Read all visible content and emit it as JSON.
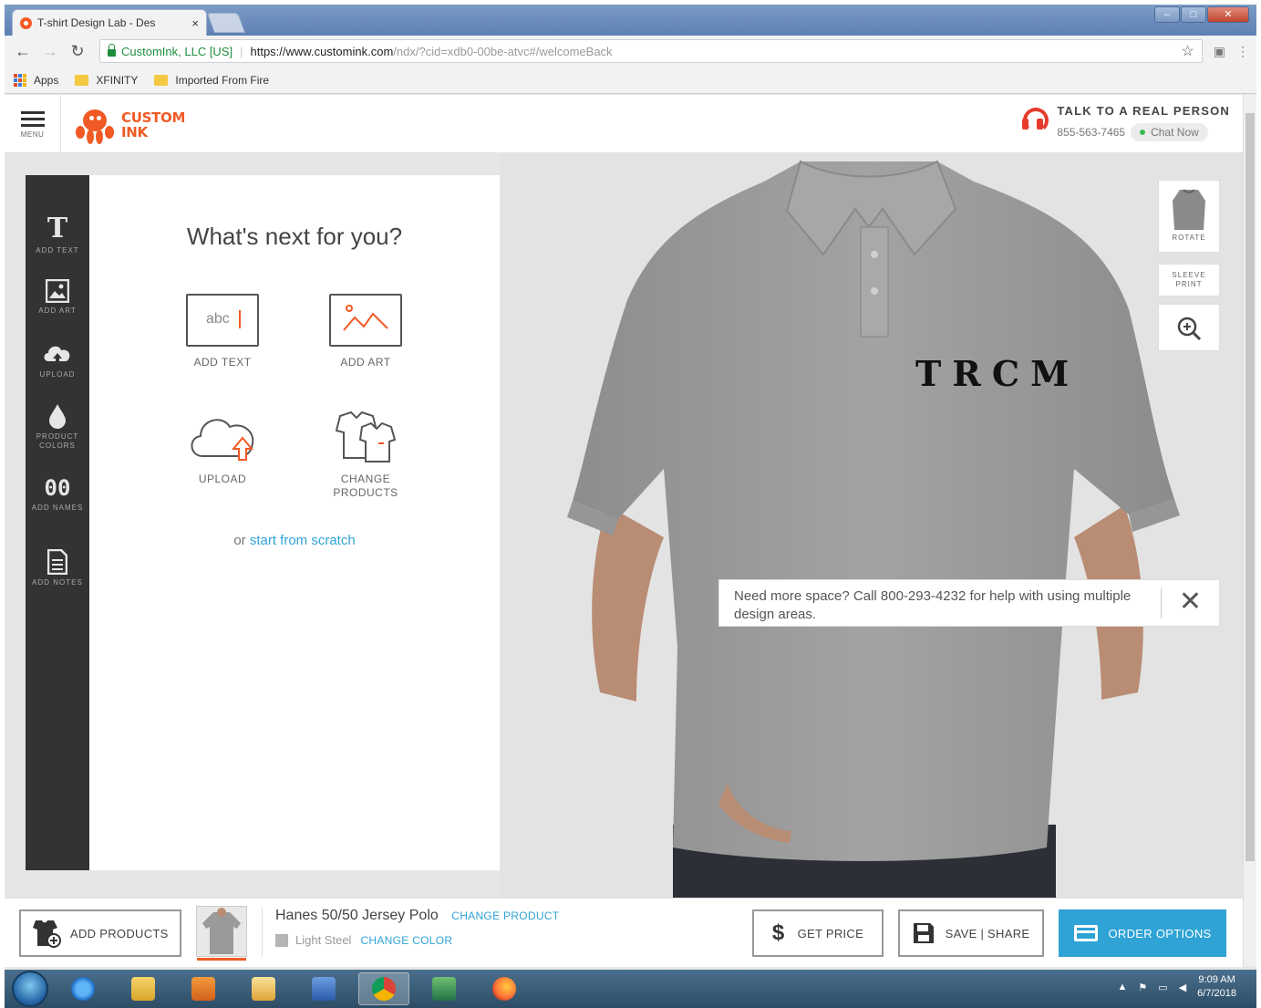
{
  "browser": {
    "tab_title": "T-shirt Design Lab - Des",
    "tab_close": "×",
    "secure_label": "CustomInk, LLC [US]",
    "url_host": "https://www.customink.com",
    "url_path": "/ndx/?cid=xdb0-00be-atvc#/welcomeBack",
    "bookmarks": [
      "Apps",
      "XFINITY",
      "Imported From Fire"
    ]
  },
  "header": {
    "menu_label": "MENU",
    "logo_line1": "CUSTOM",
    "logo_line2": "INK",
    "talk_title": "TALK TO A REAL PERSON",
    "phone": "855-563-7465",
    "chat_label": "Chat Now"
  },
  "tools": [
    {
      "label": "ADD TEXT",
      "icon": "text-icon"
    },
    {
      "label": "ADD ART",
      "icon": "image-icon"
    },
    {
      "label": "UPLOAD",
      "icon": "cloud-upload-icon"
    },
    {
      "label": "PRODUCT COLORS",
      "icon": "droplet-icon"
    },
    {
      "label": "ADD NAMES",
      "icon": "numbers-icon"
    },
    {
      "label": "ADD NOTES",
      "icon": "document-icon"
    }
  ],
  "panel": {
    "title": "What's next for you?",
    "options": [
      {
        "label": "ADD TEXT",
        "icon": "text-box-icon",
        "icon_text": "abc"
      },
      {
        "label": "ADD ART",
        "icon": "art-icon"
      },
      {
        "label": "UPLOAD",
        "icon": "cloud-upload-icon"
      },
      {
        "label": "CHANGE PRODUCTS",
        "icon": "shirts-icon"
      }
    ],
    "scratch_prefix": "or",
    "scratch_link": "start from scratch"
  },
  "stage": {
    "design_text": "TRCM",
    "shirt_color": "#9e9e9e",
    "side_buttons": [
      "ROTATE",
      "SLEEVE PRINT"
    ],
    "zoom_icon": "zoom-in-icon",
    "notice": "Need more space? Call 800-293-4232 for help with using multiple design areas.",
    "notice_close": "✕"
  },
  "bottom": {
    "add_products": "ADD PRODUCTS",
    "product_name": "Hanes 50/50 Jersey Polo",
    "change_product": "CHANGE PRODUCT",
    "color_name": "Light Steel",
    "change_color": "CHANGE COLOR",
    "get_price": "GET PRICE",
    "save_share": "SAVE | SHARE",
    "order_options": "ORDER OPTIONS",
    "accent_color": "#2fa3d6"
  },
  "taskbar": {
    "apps": [
      "internet-explorer-icon",
      "file-explorer-icon",
      "media-player-icon",
      "outlook-icon",
      "word-icon",
      "chrome-icon",
      "excel-icon",
      "firefox-icon"
    ],
    "time": "9:09 AM",
    "date": "6/7/2018"
  }
}
